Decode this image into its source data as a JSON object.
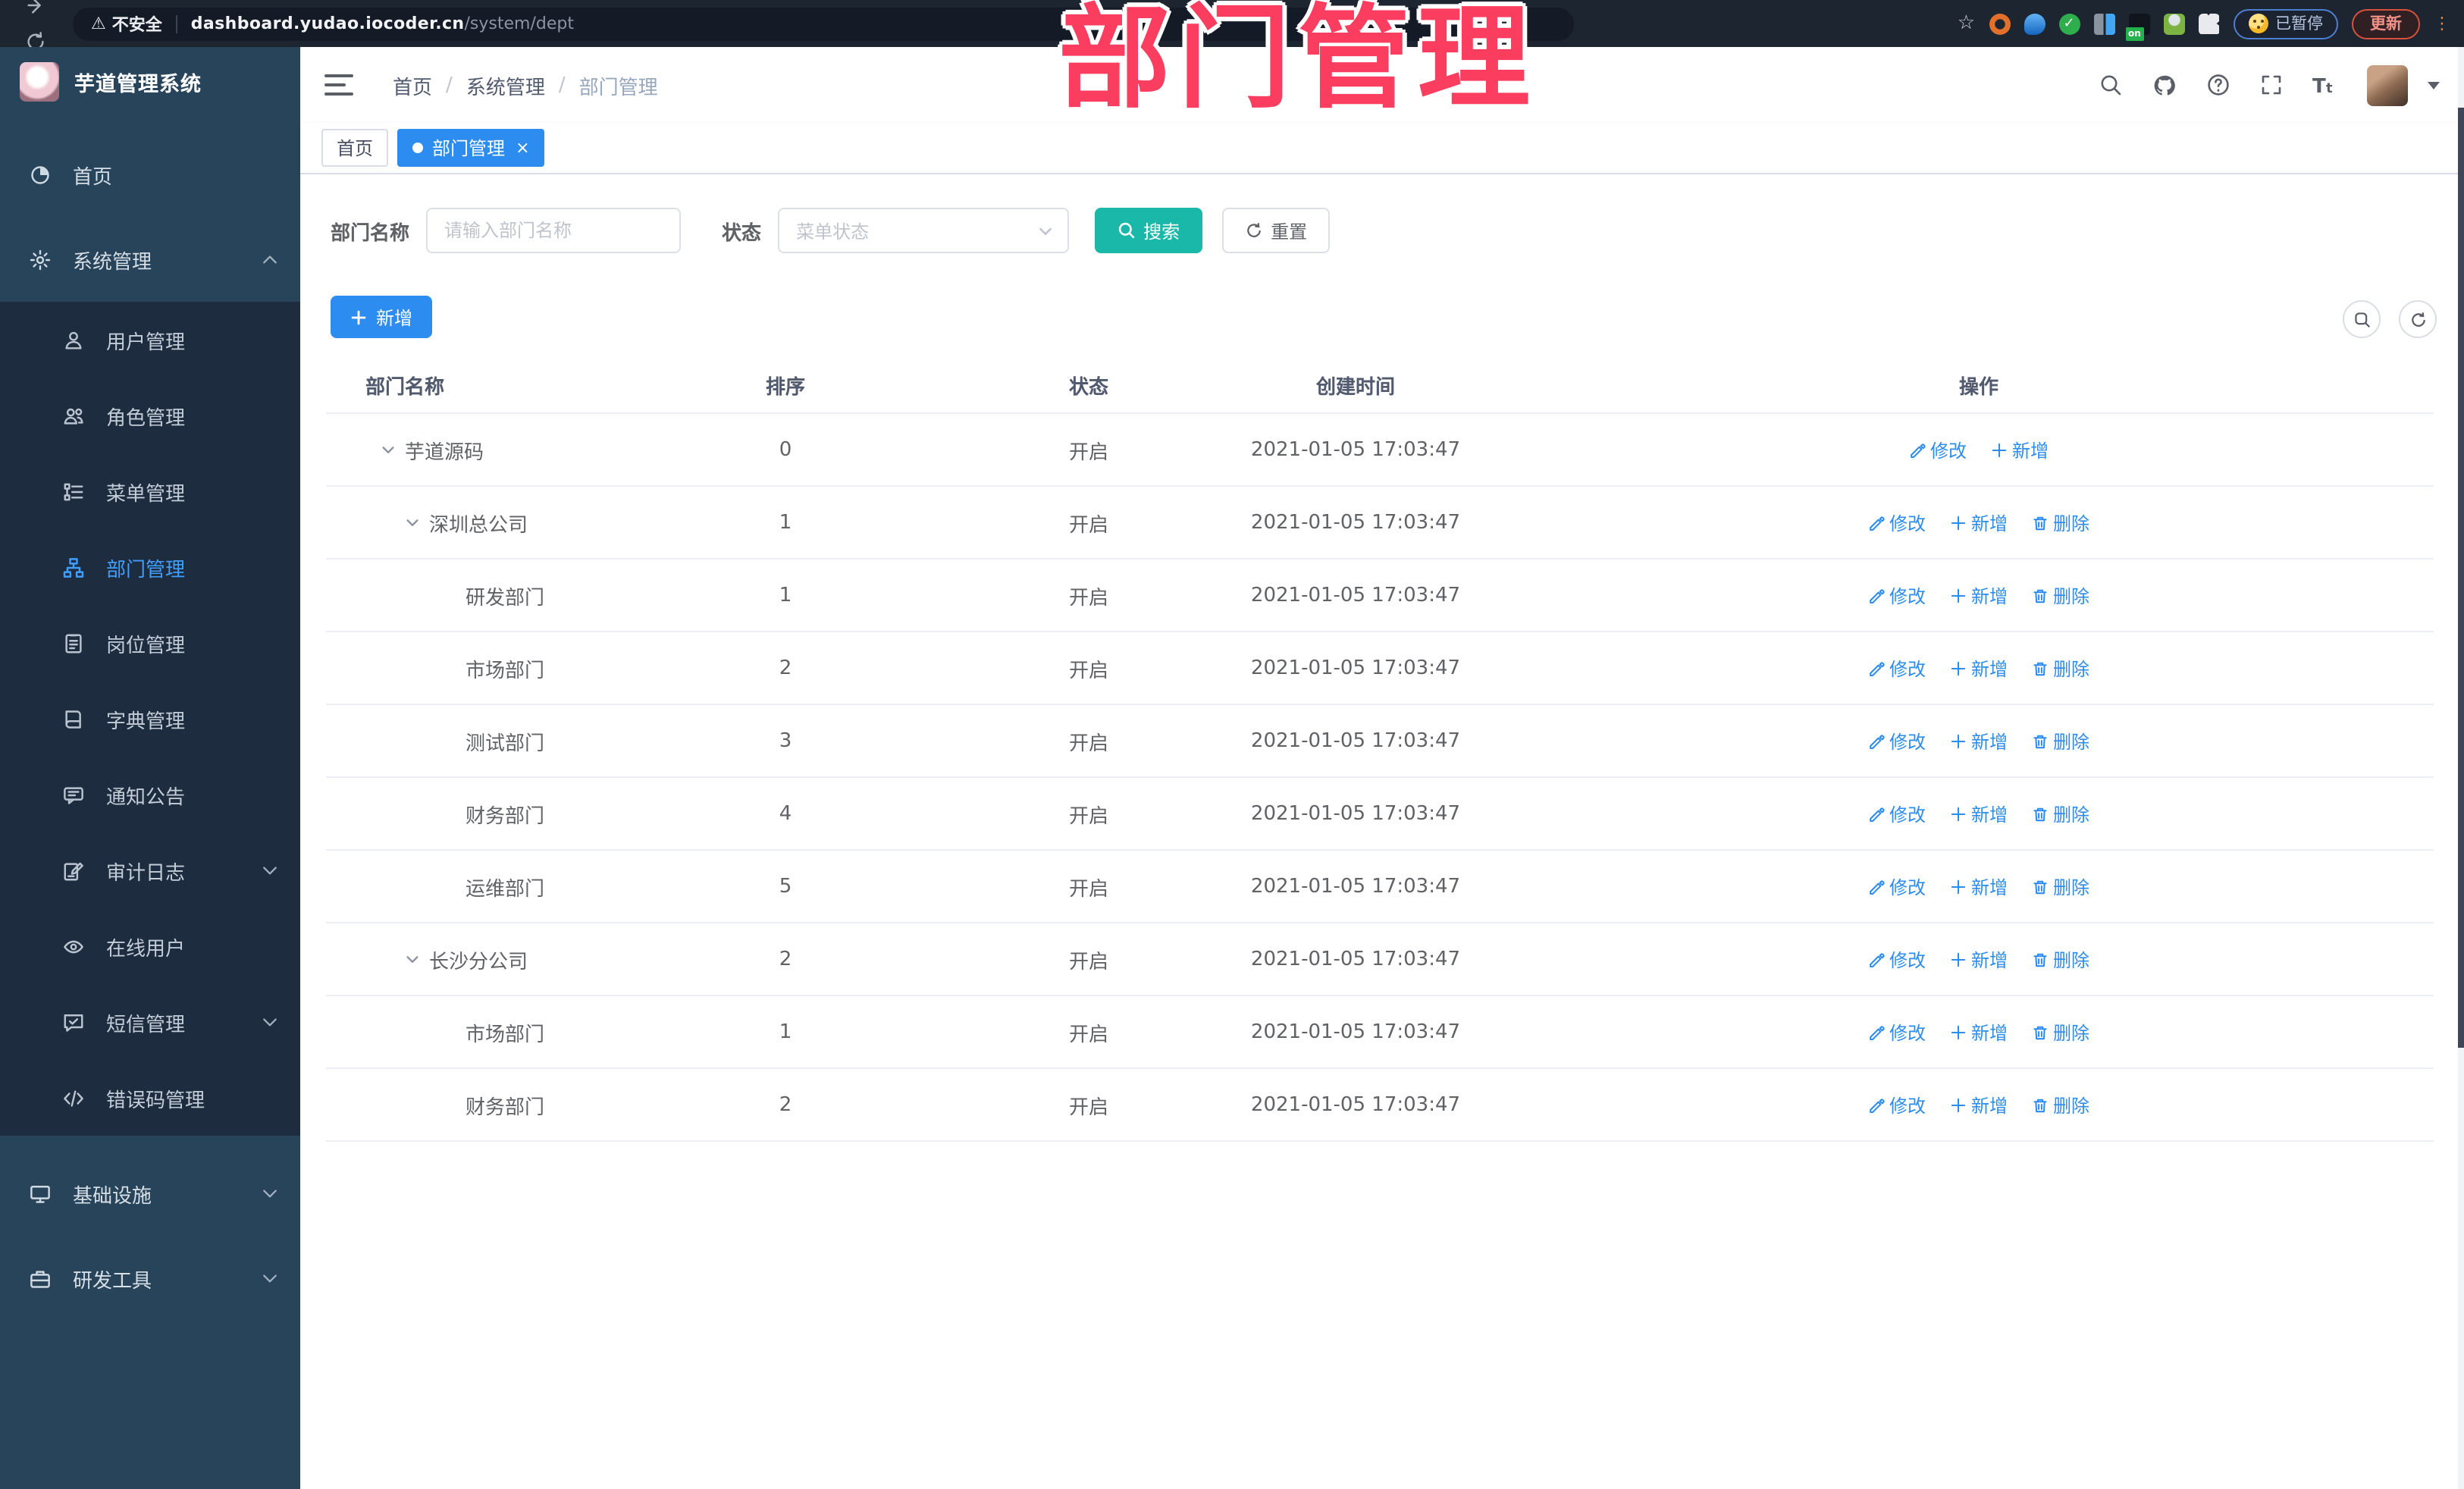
{
  "browser": {
    "nav_icons": [
      "back-icon",
      "forward-icon",
      "reload-icon",
      "home-icon"
    ],
    "security_label": "不安全",
    "url_host": "dashboard.yudao.iocoder.cn",
    "url_path": "/system/dept",
    "extension_icons": [
      "ring-extension-icon",
      "drop-extension-icon",
      "check-extension-icon",
      "grid-extension-icon",
      "vpn-on-extension-icon",
      "person-extension-icon",
      "puzzle-extension-icon"
    ],
    "paused_label": "已暂停",
    "update_label": "更新"
  },
  "annotation": {
    "text": "部门管理"
  },
  "sidebar": {
    "title": "芋道管理系统",
    "items": [
      {
        "label": "首页",
        "icon": "dashboard-icon",
        "type": "top"
      },
      {
        "label": "系统管理",
        "icon": "gear-icon",
        "type": "top",
        "arrow": "up"
      },
      {
        "label": "用户管理",
        "icon": "user-icon",
        "type": "sub"
      },
      {
        "label": "角色管理",
        "icon": "roles-icon",
        "type": "sub"
      },
      {
        "label": "菜单管理",
        "icon": "menu-list-icon",
        "type": "sub"
      },
      {
        "label": "部门管理",
        "icon": "org-tree-icon",
        "type": "sub",
        "active": true
      },
      {
        "label": "岗位管理",
        "icon": "post-badge-icon",
        "type": "sub"
      },
      {
        "label": "字典管理",
        "icon": "dict-book-icon",
        "type": "sub"
      },
      {
        "label": "通知公告",
        "icon": "notice-icon",
        "type": "sub"
      },
      {
        "label": "审计日志",
        "icon": "audit-log-icon",
        "type": "sub",
        "arrow": "down"
      },
      {
        "label": "在线用户",
        "icon": "online-user-icon",
        "type": "sub"
      },
      {
        "label": "短信管理",
        "icon": "sms-icon",
        "type": "sub",
        "arrow": "down"
      },
      {
        "label": "错误码管理",
        "icon": "error-code-icon",
        "type": "sub"
      },
      {
        "label": "基础设施",
        "icon": "infra-icon",
        "type": "top",
        "arrow": "down",
        "gap_before": true
      },
      {
        "label": "研发工具",
        "icon": "devtool-icon",
        "type": "top",
        "arrow": "down"
      }
    ]
  },
  "header": {
    "breadcrumb": [
      "首页",
      "系统管理",
      "部门管理"
    ],
    "right_icons": [
      "search-icon",
      "github-icon",
      "help-icon",
      "fullscreen-icon",
      "font-size-icon"
    ]
  },
  "tabs": [
    {
      "label": "首页",
      "active": false,
      "closable": false
    },
    {
      "label": "部门管理",
      "active": true,
      "closable": true
    }
  ],
  "filters": {
    "name_label": "部门名称",
    "name_placeholder": "请输入部门名称",
    "status_label": "状态",
    "status_placeholder": "菜单状态",
    "search_label": "搜索",
    "reset_label": "重置"
  },
  "toolbar": {
    "add_label": "新增"
  },
  "table": {
    "columns": [
      "部门名称",
      "排序",
      "状态",
      "创建时间",
      "操作"
    ],
    "action_labels": {
      "edit": "修改",
      "add": "新增",
      "delete": "删除"
    },
    "rows": [
      {
        "name": "芋道源码",
        "indent": 0,
        "expandable": true,
        "sort": "0",
        "status": "开启",
        "created": "2021-01-05 17:03:47",
        "actions": [
          "edit",
          "add"
        ]
      },
      {
        "name": "深圳总公司",
        "indent": 1,
        "expandable": true,
        "sort": "1",
        "status": "开启",
        "created": "2021-01-05 17:03:47",
        "actions": [
          "edit",
          "add",
          "delete"
        ]
      },
      {
        "name": "研发部门",
        "indent": 2,
        "expandable": false,
        "sort": "1",
        "status": "开启",
        "created": "2021-01-05 17:03:47",
        "actions": [
          "edit",
          "add",
          "delete"
        ]
      },
      {
        "name": "市场部门",
        "indent": 2,
        "expandable": false,
        "sort": "2",
        "status": "开启",
        "created": "2021-01-05 17:03:47",
        "actions": [
          "edit",
          "add",
          "delete"
        ]
      },
      {
        "name": "测试部门",
        "indent": 2,
        "expandable": false,
        "sort": "3",
        "status": "开启",
        "created": "2021-01-05 17:03:47",
        "actions": [
          "edit",
          "add",
          "delete"
        ]
      },
      {
        "name": "财务部门",
        "indent": 2,
        "expandable": false,
        "sort": "4",
        "status": "开启",
        "created": "2021-01-05 17:03:47",
        "actions": [
          "edit",
          "add",
          "delete"
        ]
      },
      {
        "name": "运维部门",
        "indent": 2,
        "expandable": false,
        "sort": "5",
        "status": "开启",
        "created": "2021-01-05 17:03:47",
        "actions": [
          "edit",
          "add",
          "delete"
        ]
      },
      {
        "name": "长沙分公司",
        "indent": 1,
        "expandable": true,
        "sort": "2",
        "status": "开启",
        "created": "2021-01-05 17:03:47",
        "actions": [
          "edit",
          "add",
          "delete"
        ]
      },
      {
        "name": "市场部门",
        "indent": 2,
        "expandable": false,
        "sort": "1",
        "status": "开启",
        "created": "2021-01-05 17:03:47",
        "actions": [
          "edit",
          "add",
          "delete"
        ]
      },
      {
        "name": "财务部门",
        "indent": 2,
        "expandable": false,
        "sort": "2",
        "status": "开启",
        "created": "2021-01-05 17:03:47",
        "actions": [
          "edit",
          "add",
          "delete"
        ]
      }
    ]
  },
  "colors": {
    "accent_blue": "#2d8cf0",
    "search_teal": "#1ab8a9",
    "annotation_pink": "#fb3d5f",
    "sidebar_bg": "#27445a",
    "submenu_bg": "#1d2c3f",
    "toolbar_bg": "#1d2530"
  }
}
